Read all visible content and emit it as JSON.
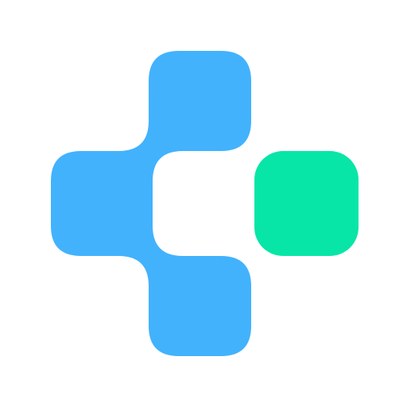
{
  "logo": {
    "icon": "pixel-cross-logo-icon",
    "colors": {
      "background": "#ffffff",
      "blue": "#42B2FD",
      "green": "#07E6A6"
    }
  }
}
